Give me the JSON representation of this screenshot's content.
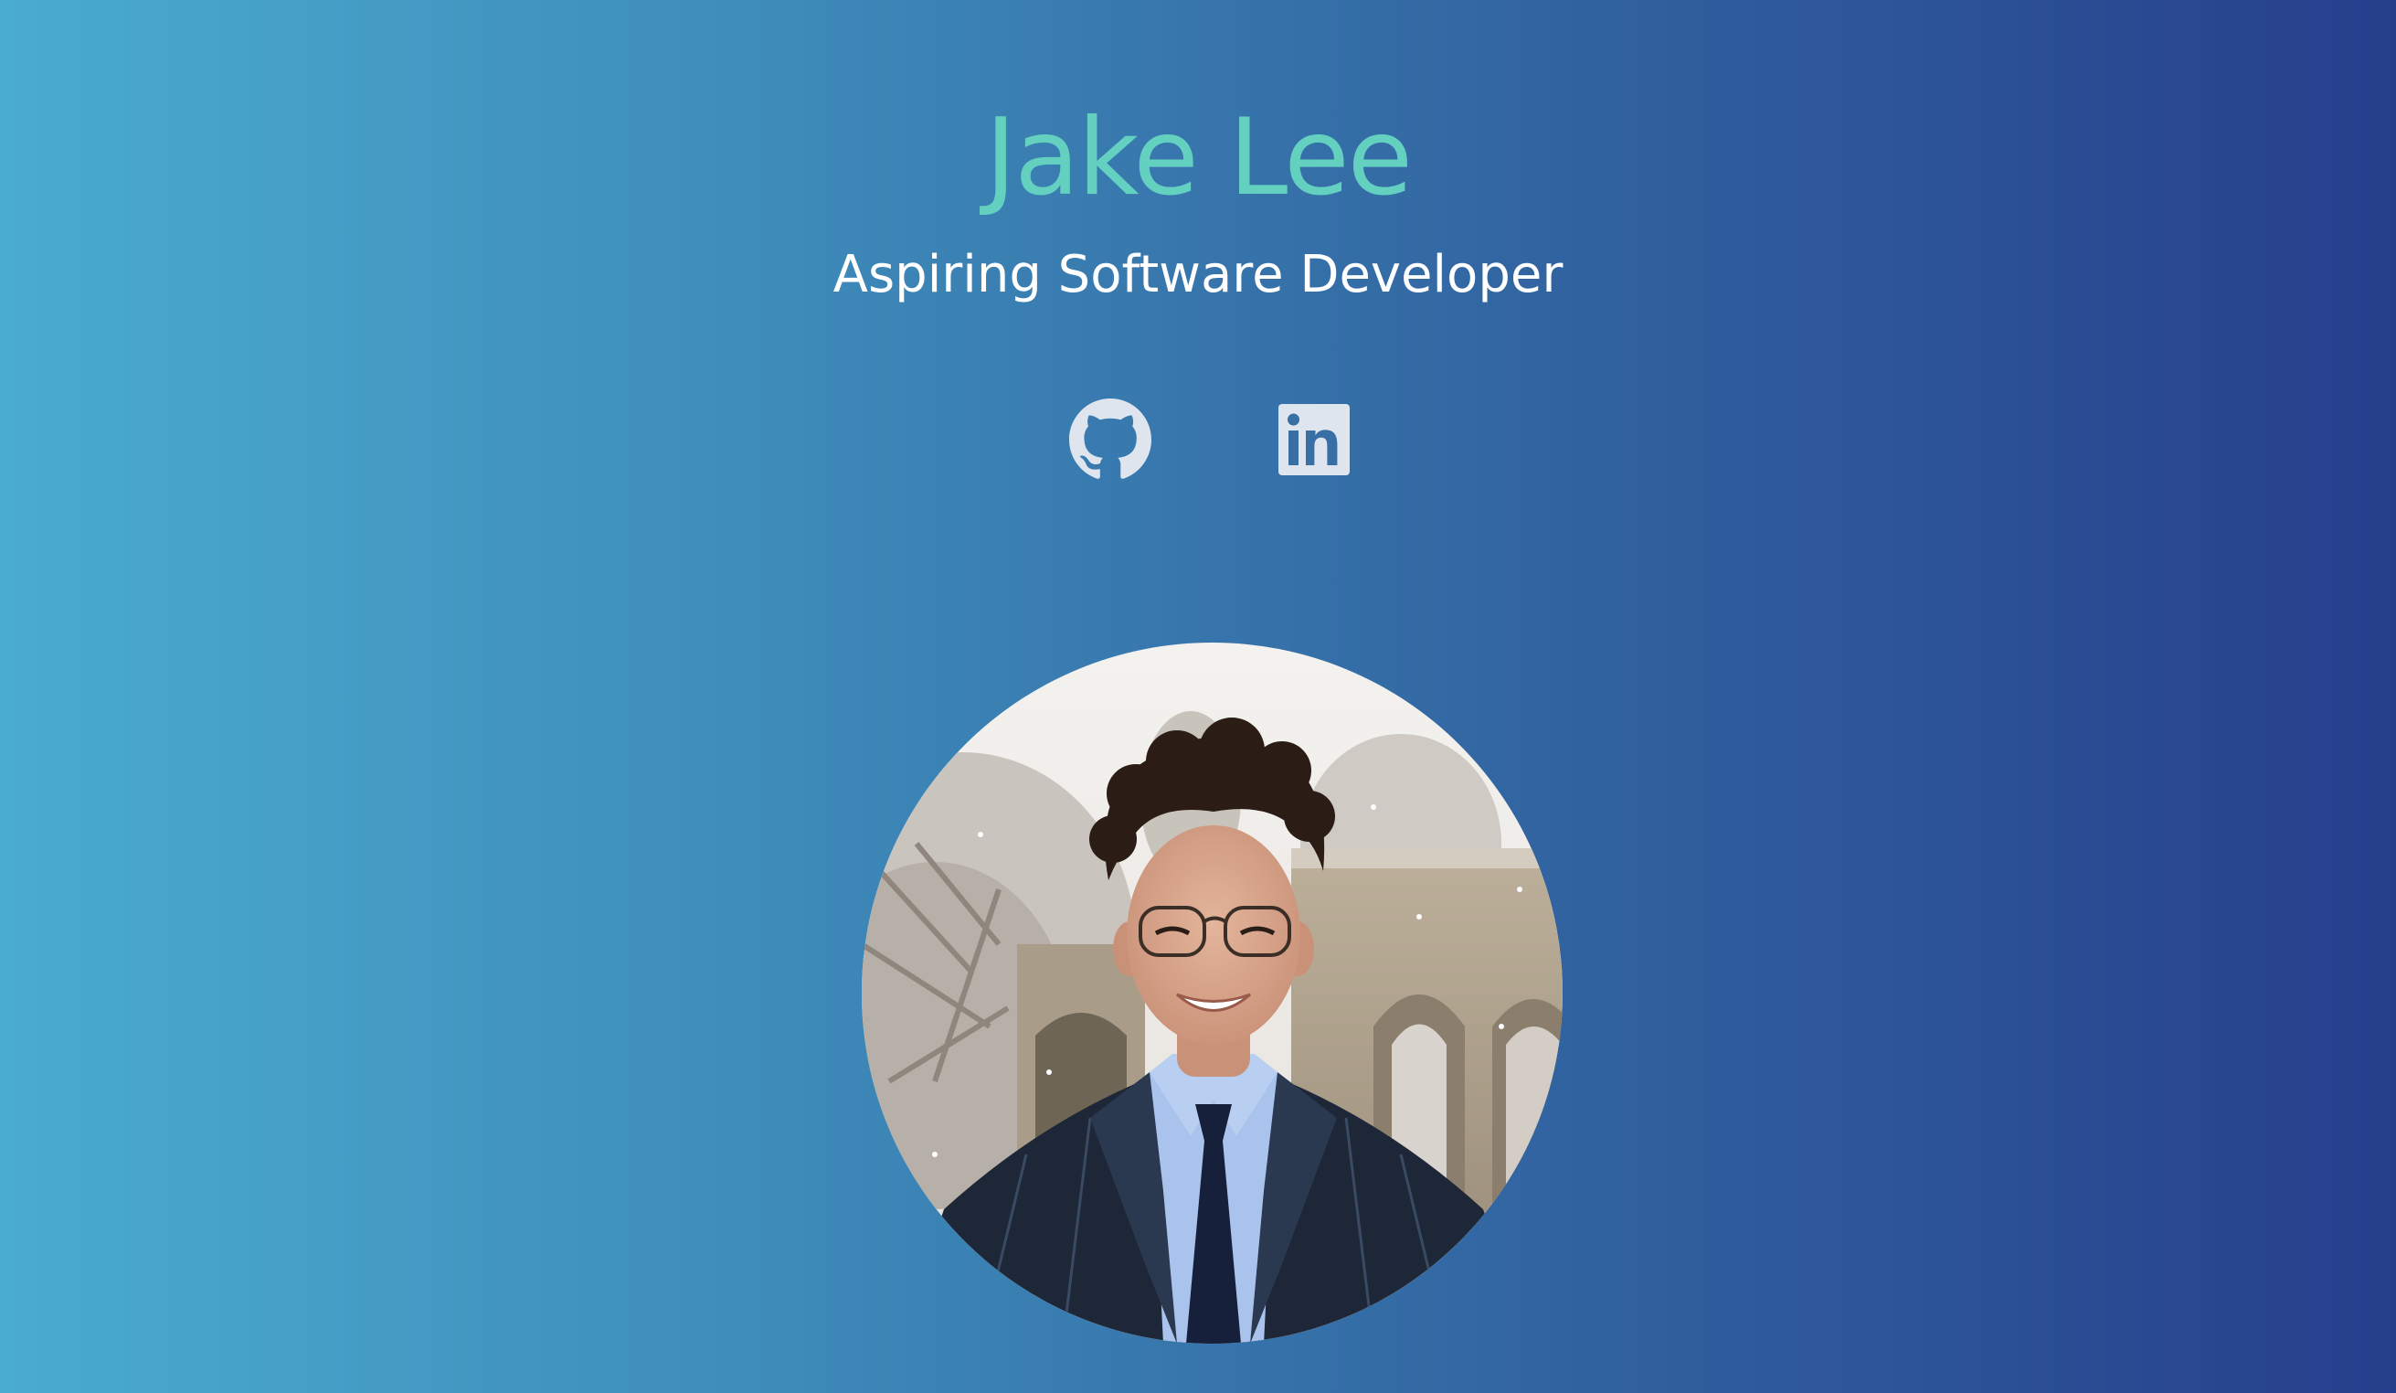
{
  "profile": {
    "name": "Jake Lee",
    "tagline": "Aspiring Software Developer"
  },
  "social": [
    {
      "icon": "github-icon"
    },
    {
      "icon": "linkedin-icon"
    }
  ],
  "colors": {
    "name_accent": "#64d1c0",
    "tagline": "#ffffff",
    "gradient_start": "#4aaccf",
    "gradient_end": "#263f8c",
    "icon": "#dfe5ee"
  }
}
